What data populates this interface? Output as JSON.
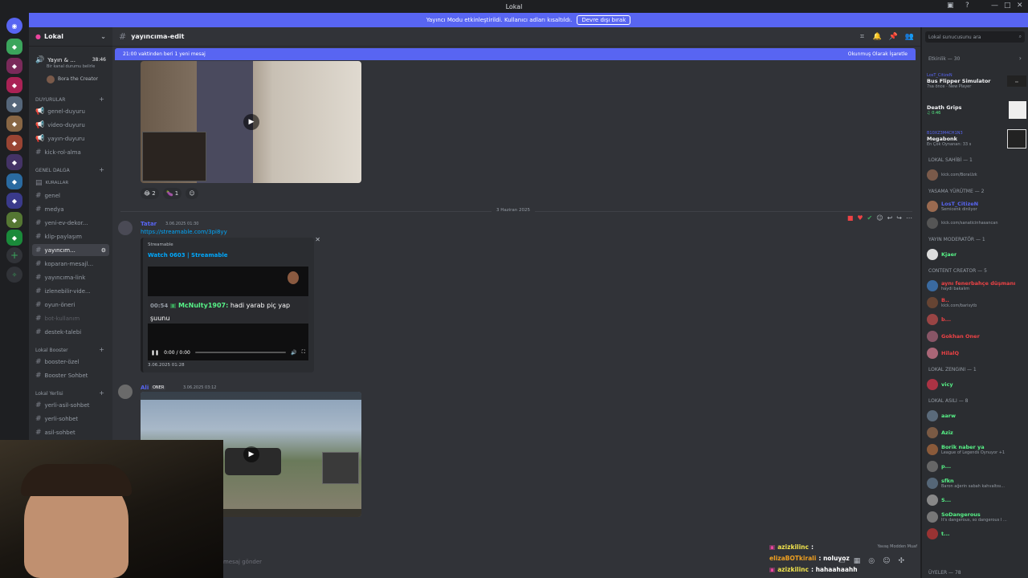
{
  "window": {
    "title": "Lokal"
  },
  "banner": {
    "text": "Yayıncı Modu etkinleştirildi. Kullanıcı adları kısaltıldı.",
    "button": "Devre dışı bırak"
  },
  "server": {
    "name": "Lokal"
  },
  "voice": {
    "channel": "Yayın & ...",
    "time": "38:46",
    "status": "Bir kanal durumu belirle",
    "user": "Bora the Creator"
  },
  "channels": {
    "cat_duyurular": "DUYURULAR",
    "duyurular": [
      "genel-duyuru",
      "video-duyuru",
      "yayın-duyuru",
      "kick-rol-alma"
    ],
    "cat_genel": "GENEL DALGA",
    "kurallar": "KURALLAR",
    "genel": [
      "genel",
      "medya",
      "yeni-ev-dekor...",
      "klip-paylaşım",
      "yayıncım...",
      "koparan-mesajl...",
      "yayıncıma-link",
      "izlenebilir-vide...",
      "oyun-öneri",
      "bot-kullanım",
      "destek-talebi"
    ],
    "cat_booster": "Lokal Booster",
    "booster": [
      "booster-özel",
      "Booster Sohbet"
    ],
    "cat_yerli": "Lokal Yerlisi",
    "yerli": [
      "yerli-asil-sohbet",
      "yerli-sohbet",
      "asil-sohbet"
    ]
  },
  "main": {
    "channel_name": "yayıncıma-edit",
    "new_messages": "21:00 vaktinden beri 1 yeni mesaj",
    "mark_read": "Okunmuş Olarak İşaretle",
    "reactions": [
      {
        "emoji": "😂",
        "count": "2"
      },
      {
        "emoji": "🍆",
        "count": "1"
      }
    ],
    "date_divider": "3 Haziran 2025",
    "msg1": {
      "user": "Tatar",
      "time": "3.06.2025 01:30",
      "link": "https://streamable.com/3pi8yy",
      "embed": {
        "provider": "Streamable",
        "title": "Watch 0603 | Streamable",
        "time_badge": "00:54",
        "chat_user": "McNulty1907:",
        "chat_text": "hadi yarab piç yap şuunu",
        "player_time": "0:00 / 0:00",
        "footer": "3.06.2025 01:28"
      }
    },
    "msg2": {
      "user": "Ali",
      "role": "ONER",
      "time": "3.06.2025 03:12"
    },
    "input_placeholder": "mesaj gönder"
  },
  "members": {
    "search_placeholder": "Lokal sunucusunu ara",
    "activity": {
      "header": "Etkinlik — 30",
      "items": [
        {
          "user": "LosT_CitizeN",
          "game": "Bus Flipper Simulator",
          "detail": "7sa önce · New Player"
        },
        {
          "user": "",
          "game": "Death Grips",
          "detail": "♫ 0:46"
        },
        {
          "user": "B10XZ3M4CH1N3",
          "game": "Megabonk",
          "detail": "En Çok Oynanan: 33 s"
        }
      ]
    },
    "groups": [
      {
        "title": "LOKAL SAHİBİ — 1",
        "members": [
          {
            "name": "",
            "sub": "kick.com/BoraUzk",
            "color": "#ffffff",
            "av": "#7a5a4a"
          }
        ]
      },
      {
        "title": "YASAMA YÜRÜTME — 2",
        "members": [
          {
            "name": "LosT_CitizeN",
            "sub": "Semicenk dinliyor",
            "color": "#5865f2",
            "av": "#9a6a50"
          },
          {
            "name": "",
            "sub": "kick.com/sanaticinhasancan",
            "color": "#ffffff",
            "av": "#555"
          }
        ]
      },
      {
        "title": "Yayın Moderatör — 1",
        "members": [
          {
            "name": "Kjaer",
            "sub": "",
            "color": "#57f287",
            "av": "#dddddd"
          }
        ]
      },
      {
        "title": "CONTENT CREATOR — 5",
        "members": [
          {
            "name": "aynı fenerbahçe düşmanı",
            "sub": "haydi bakalım",
            "color": "#ed4245",
            "av": "#3a6aa0"
          },
          {
            "name": "B..",
            "sub": "kick.com/barisytb",
            "color": "#ed4245",
            "av": "#664433"
          },
          {
            "name": "b...",
            "sub": "",
            "color": "#ed4245",
            "av": "#994444"
          },
          {
            "name": "Gokhan Oner",
            "sub": "",
            "color": "#ed4245",
            "av": "#885566"
          },
          {
            "name": "HilalQ",
            "sub": "",
            "color": "#ed4245",
            "av": "#aa6677"
          }
        ]
      },
      {
        "title": "Lokal Zengini — 1",
        "members": [
          {
            "name": "vicy",
            "sub": "",
            "color": "#57f287",
            "av": "#aa3344"
          }
        ]
      },
      {
        "title": "Lokal Asili — 8",
        "members": [
          {
            "name": "aarw",
            "sub": "",
            "color": "#57f287",
            "av": "#5a6a7a"
          },
          {
            "name": "Aziz",
            "sub": "",
            "color": "#57f287",
            "av": "#7a5a44"
          },
          {
            "name": "Borik naber ya",
            "sub": "League of Legends Oynuyor +1",
            "color": "#57f287",
            "av": "#8a5a3a"
          },
          {
            "name": "p...",
            "sub": "",
            "color": "#57f287",
            "av": "#666"
          },
          {
            "name": "sfkn",
            "sub": "Baron ağerin sabah kahvaltısı...",
            "color": "#57f287",
            "av": "#556677"
          },
          {
            "name": "S...",
            "sub": "",
            "color": "#57f287",
            "av": "#888"
          },
          {
            "name": "SoDangerous",
            "sub": "It's dangerous, so dangerous I ...",
            "color": "#57f287",
            "av": "#777"
          },
          {
            "name": "t...",
            "sub": "",
            "color": "#57f287",
            "av": "#993333"
          }
        ]
      }
    ],
    "footer": "ÜYELER — 78"
  },
  "overlay": {
    "lines": [
      {
        "user": "azizkilinc",
        "text": ":",
        "color": "#f0e34d"
      },
      {
        "user": "elizaBOTkirali",
        "text": ": noluyoz",
        "color": "#f0a020"
      },
      {
        "user": "azizkilinc",
        "text": ": hahaahaahh",
        "color": "#f0e34d"
      }
    ],
    "mod": "Yavaş Modden Muaf"
  }
}
